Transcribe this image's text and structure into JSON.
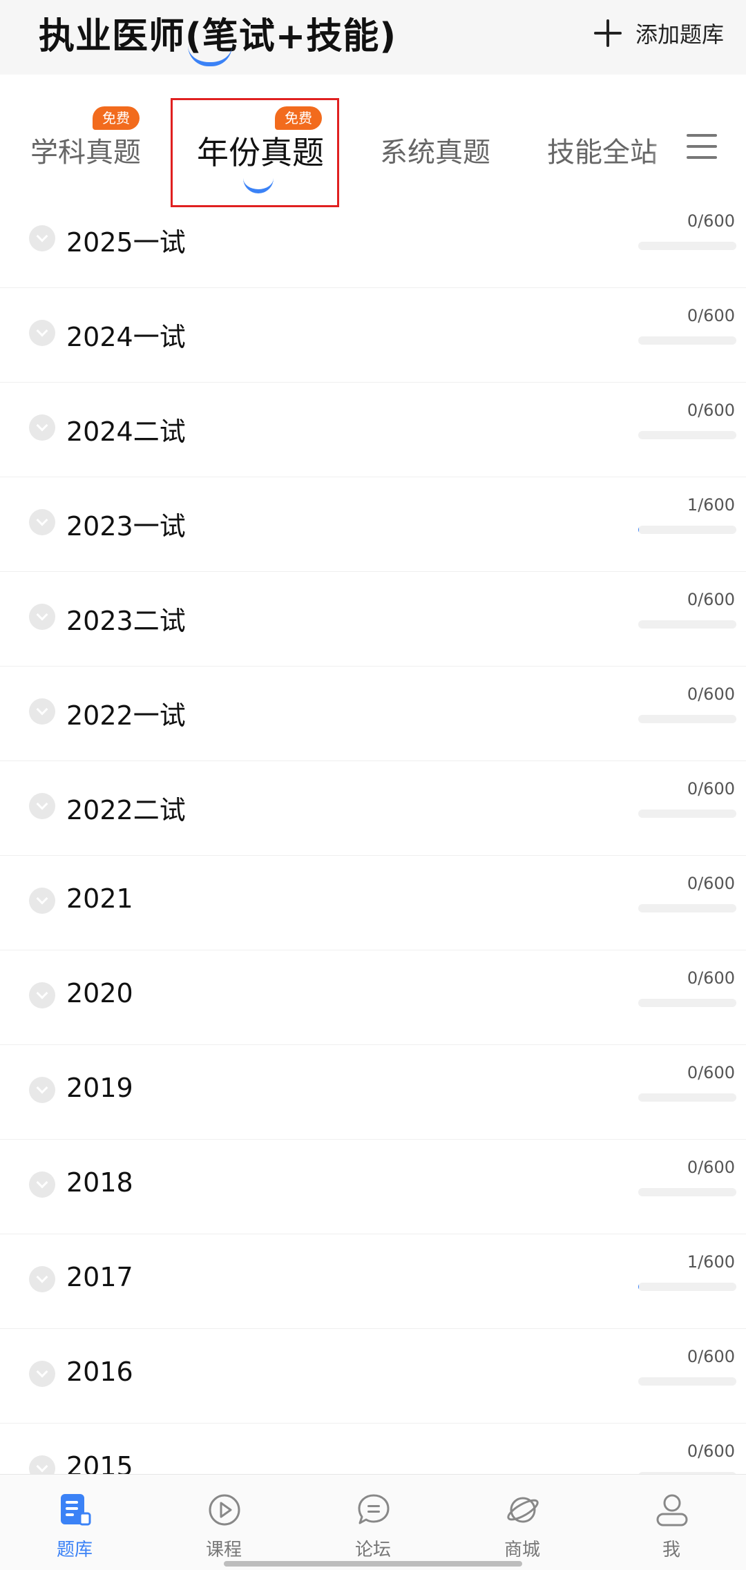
{
  "header": {
    "title": "执业医师(笔试+技能)",
    "add_label": "添加题库"
  },
  "tabs": [
    {
      "label": "学科真题",
      "badge": "免费",
      "active": false
    },
    {
      "label": "年份真题",
      "badge": "免费",
      "active": true
    },
    {
      "label": "系统真题",
      "badge": "",
      "active": false
    },
    {
      "label": "技能全站",
      "badge": "",
      "active": false
    }
  ],
  "colors": {
    "accent": "#3b82f6",
    "badge": "#f26b1d",
    "highlight_border": "#e02020"
  },
  "list": [
    {
      "label": "2025一试",
      "count": "0/600",
      "done": 0,
      "total": 600
    },
    {
      "label": "2024一试",
      "count": "0/600",
      "done": 0,
      "total": 600
    },
    {
      "label": "2024二试",
      "count": "0/600",
      "done": 0,
      "total": 600
    },
    {
      "label": "2023一试",
      "count": "1/600",
      "done": 1,
      "total": 600
    },
    {
      "label": "2023二试",
      "count": "0/600",
      "done": 0,
      "total": 600
    },
    {
      "label": "2022一试",
      "count": "0/600",
      "done": 0,
      "total": 600
    },
    {
      "label": "2022二试",
      "count": "0/600",
      "done": 0,
      "total": 600
    },
    {
      "label": "2021",
      "count": "0/600",
      "done": 0,
      "total": 600
    },
    {
      "label": "2020",
      "count": "0/600",
      "done": 0,
      "total": 600
    },
    {
      "label": "2019",
      "count": "0/600",
      "done": 0,
      "total": 600
    },
    {
      "label": "2018",
      "count": "0/600",
      "done": 0,
      "total": 600
    },
    {
      "label": "2017",
      "count": "1/600",
      "done": 1,
      "total": 600
    },
    {
      "label": "2016",
      "count": "0/600",
      "done": 0,
      "total": 600
    },
    {
      "label": "2015",
      "count": "0/600",
      "done": 0,
      "total": 600
    }
  ],
  "bottom_nav": [
    {
      "label": "题库",
      "icon": "question-bank-icon",
      "active": true
    },
    {
      "label": "课程",
      "icon": "play-circle-icon",
      "active": false
    },
    {
      "label": "论坛",
      "icon": "chat-bubble-icon",
      "active": false
    },
    {
      "label": "商城",
      "icon": "planet-icon",
      "active": false
    },
    {
      "label": "我",
      "icon": "user-icon",
      "active": false
    }
  ]
}
